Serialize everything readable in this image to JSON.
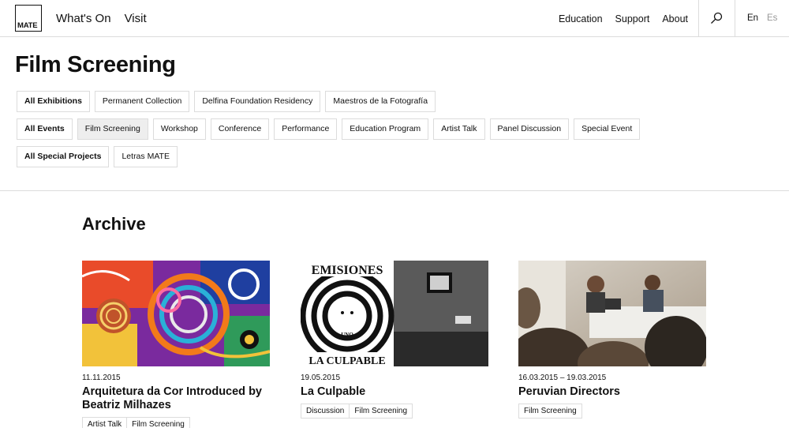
{
  "header": {
    "logo_text": "MATE",
    "nav_left": [
      "What's On",
      "Visit"
    ],
    "nav_right": [
      "Education",
      "Support",
      "About"
    ],
    "lang_en": "En",
    "lang_es": "Es"
  },
  "page_title": "Film Screening",
  "filters": {
    "exhibitions": [
      "All Exhibitions",
      "Permanent Collection",
      "Delfina Foundation Residency",
      "Maestros de la Fotografía"
    ],
    "events": [
      "All Events",
      "Film Screening",
      "Workshop",
      "Conference",
      "Performance",
      "Education Program",
      "Artist Talk",
      "Panel Discussion",
      "Special Event"
    ],
    "special_projects": [
      "All Special Projects",
      "Letras MATE"
    ]
  },
  "archive": {
    "title": "Archive",
    "cards": [
      {
        "date": "11.11.2015",
        "title": "Arquitetura da Cor Introduced by Beatriz Milhazes",
        "tags": [
          "Artist Talk",
          "Film Screening"
        ]
      },
      {
        "date": "19.05.2015",
        "title": "La Culpable",
        "tags": [
          "Discussion",
          "Film Screening"
        ],
        "poster_top": "EMISIONES",
        "poster_mid": "UNO",
        "poster_bottom": "LA CULPABLE"
      },
      {
        "date": "16.03.2015 – 19.03.2015",
        "title": "Peruvian Directors",
        "tags": [
          "Film Screening"
        ]
      }
    ]
  },
  "colors": {
    "border": "#dcdcdc",
    "active_chip": "#eeeeee",
    "text": "#111111",
    "muted": "#999999"
  }
}
